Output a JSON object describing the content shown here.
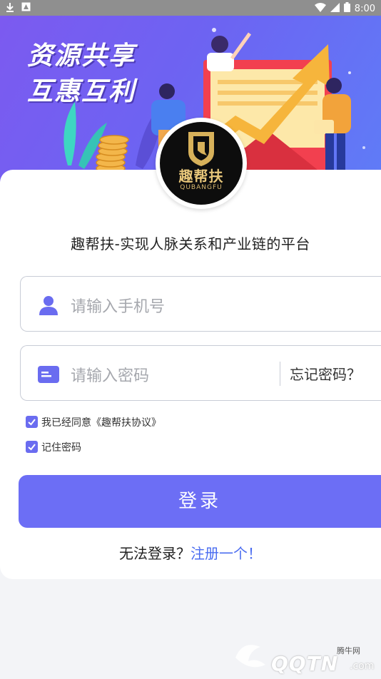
{
  "status_bar": {
    "time": "8:00"
  },
  "banner": {
    "slogan_line1": "资源共享",
    "slogan_line2": "互惠互利"
  },
  "logo": {
    "name": "趣帮扶",
    "sub": "QUBANGFU"
  },
  "tagline": "趣帮扶-实现人脉关系和产业链的平台",
  "phone_field": {
    "placeholder": "请输入手机号"
  },
  "password_field": {
    "placeholder": "请输入密码",
    "forgot_label": "忘记密码？"
  },
  "agreement": {
    "label": "我已经同意《趣帮扶协议》",
    "checked": true
  },
  "remember": {
    "label": "记住密码",
    "checked": true
  },
  "login_button": {
    "label": "登录"
  },
  "register_prompt": {
    "text": "无法登录？",
    "link": "注册一个！"
  },
  "watermark": {
    "small": "腾牛网",
    "brand": "QQTN",
    "suffix": ".com"
  },
  "colors": {
    "accent": "#6c6ef5",
    "link": "#4a6cf0",
    "banner_start": "#7c5af0",
    "banner_end": "#5f7cf7"
  }
}
